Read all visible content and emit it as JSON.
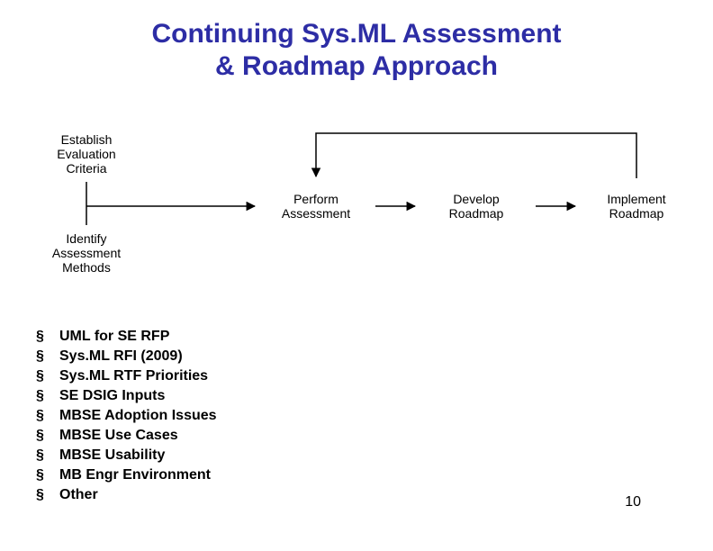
{
  "title_line1": "Continuing Sys.ML Assessment",
  "title_line2": "& Roadmap Approach",
  "hex": {
    "establish": "Establish Evaluation Criteria",
    "identify": "Identify Assessment Methods",
    "perform": "Perform Assessment",
    "develop": "Develop Roadmap",
    "implement": "Implement Roadmap"
  },
  "bullets": [
    "UML for SE RFP",
    "Sys.ML RFI (2009)",
    "Sys.ML RTF Priorities",
    "SE DSIG Inputs",
    "MBSE Adoption Issues",
    "MBSE Use Cases",
    "MBSE Usability",
    "MB Engr Environment",
    "Other"
  ],
  "page_number": "10"
}
